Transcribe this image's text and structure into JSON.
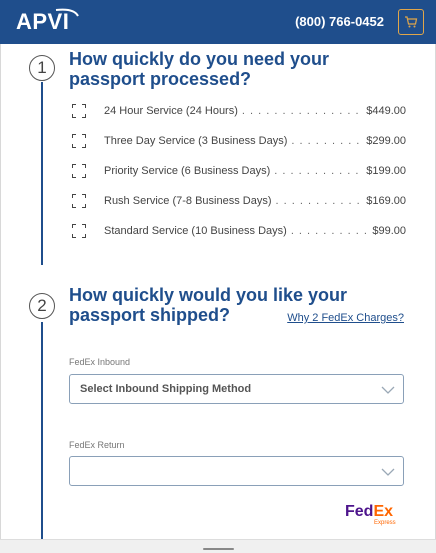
{
  "header": {
    "logo_text": "APVI",
    "phone": "(800) 766-0452",
    "brand_color": "#1f4e8c",
    "cart_border_color": "#e0a64a"
  },
  "section1": {
    "number": "1",
    "title_line1": "How quickly do you need your",
    "title_line2": "passport processed?",
    "options": [
      {
        "label": "24 Hour Service (24 Hours)",
        "price": "$449.00"
      },
      {
        "label": "Three Day Service (3 Business Days)",
        "price": "$299.00"
      },
      {
        "label": "Priority Service (6 Business Days)",
        "price": "$199.00"
      },
      {
        "label": "Rush Service (7-8 Business Days)",
        "price": "$169.00"
      },
      {
        "label": "Standard Service (10 Business Days)",
        "price": "$99.00"
      }
    ]
  },
  "section2": {
    "number": "2",
    "title_line1": "How quickly would you like your",
    "title_line2": "passport shipped?",
    "why_link": "Why 2 FedEx Charges?",
    "inbound_label": "FedEx Inbound",
    "inbound_value": "Select Inbound Shipping Method",
    "return_label": "FedEx Return",
    "return_value": ""
  },
  "fedex": {
    "fed": "Fed",
    "ex": "Ex",
    "sub": "Express"
  }
}
